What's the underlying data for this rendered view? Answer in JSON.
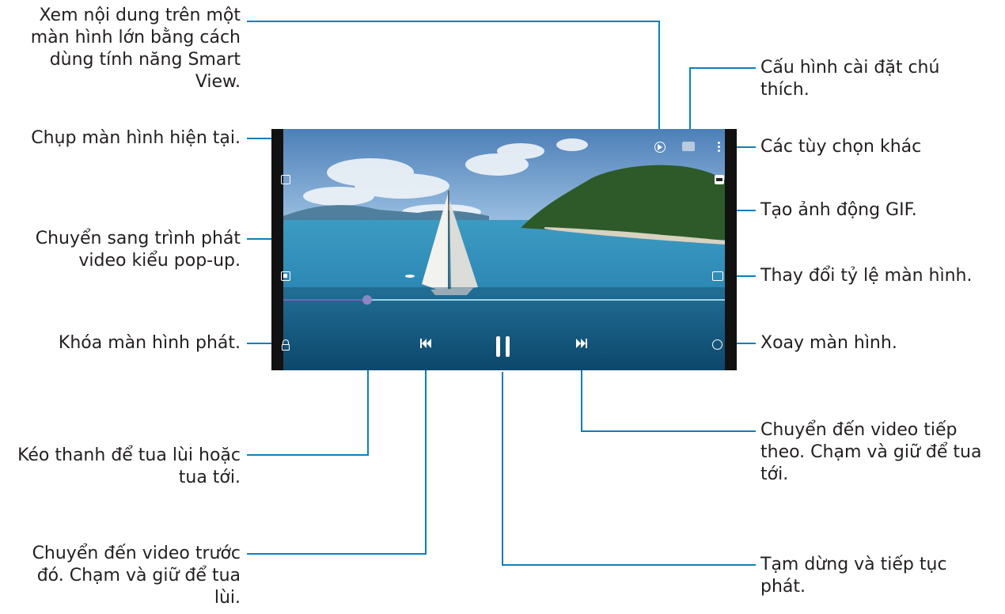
{
  "labels": {
    "smart_view": [
      "Xem nội dung trên một",
      "màn hình lớn bằng cách",
      "dùng tính năng Smart",
      "View."
    ],
    "capture": [
      "Chụp màn hình hiện tại."
    ],
    "popup": [
      "Chuyển sang trình phát",
      "video kiểu pop-up."
    ],
    "lock": [
      "Khóa màn hình phát."
    ],
    "seek": [
      "Kéo thanh để tua lùi hoặc",
      "tua tới."
    ],
    "previous": [
      "Chuyển đến video trước",
      "đó. Chạm và giữ để tua",
      "lùi."
    ],
    "subtitles": [
      "Cấu hình cài đặt chú",
      "thích."
    ],
    "more": [
      "Các tùy chọn khác"
    ],
    "gif": [
      "Tạo ảnh động GIF."
    ],
    "ratio": [
      "Thay đổi tỷ lệ màn hình."
    ],
    "rotate": [
      "Xoay màn hình."
    ],
    "next": [
      "Chuyển đến video tiếp",
      "theo. Chạm và giữ để tua",
      "tới."
    ],
    "pause": [
      "Tạm dừng và tiếp tục",
      "phát."
    ]
  },
  "player": {
    "progress_fraction": 0.19,
    "icons": [
      "capture-icon",
      "popup-icon",
      "lock-icon",
      "smart-view-icon",
      "subtitle-icon",
      "more-options-icon",
      "gif-icon",
      "aspect-ratio-icon",
      "rotate-icon",
      "previous-icon",
      "pause-icon",
      "next-icon"
    ]
  },
  "colors": {
    "leader": "#0a7fbf",
    "text": "#231f20"
  }
}
